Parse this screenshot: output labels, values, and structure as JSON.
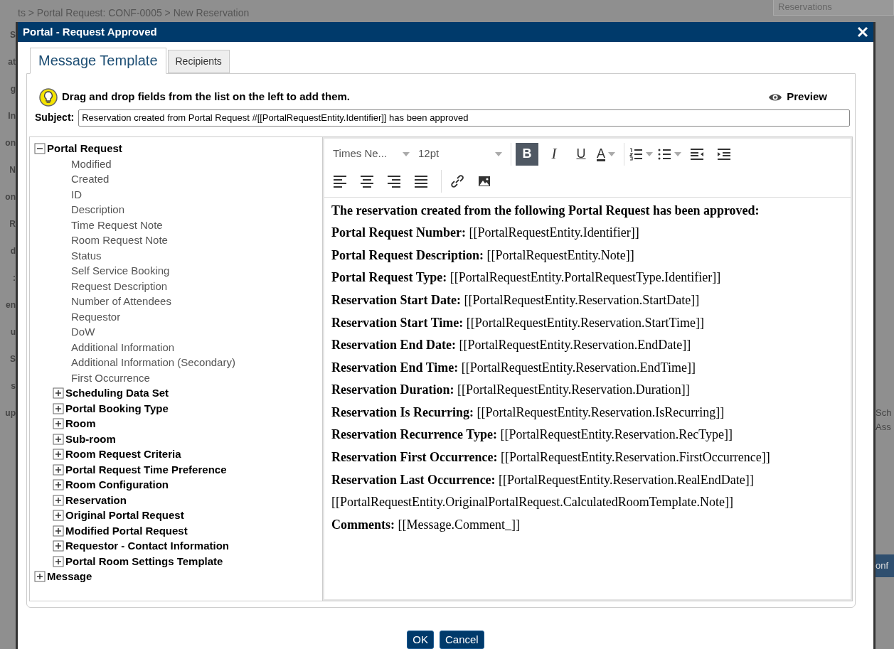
{
  "background": {
    "breadcrumb": "ts > Portal Request: CONF-0005 > New Reservation",
    "search_field": "Reservations",
    "left_fragments": [
      "S",
      "at",
      "g",
      "In",
      "on",
      "N",
      "on",
      "R",
      "d",
      ":",
      "en",
      "u",
      "S",
      "s",
      "up"
    ],
    "right_fragments": [
      "Sch",
      "Ass",
      "onf"
    ]
  },
  "dialog": {
    "title": "Portal - Request Approved",
    "tabs": [
      {
        "label": "Message Template",
        "selected": true
      },
      {
        "label": "Recipients",
        "selected": false
      }
    ],
    "hint": "Drag and drop fields from the list on the left to add them.",
    "preview": "Preview",
    "subject": {
      "label": "Subject:",
      "value": "Reservation created from Portal Request #[[PortalRequestEntity.Identifier]] has been approved"
    },
    "tree": [
      {
        "label": "Portal Request",
        "expanded": true,
        "children": [
          {
            "label": "Modified"
          },
          {
            "label": "Created"
          },
          {
            "label": "ID"
          },
          {
            "label": "Description"
          },
          {
            "label": "Time Request Note"
          },
          {
            "label": "Room Request Note"
          },
          {
            "label": "Status"
          },
          {
            "label": "Self Service Booking"
          },
          {
            "label": "Request Description"
          },
          {
            "label": "Number of Attendees"
          },
          {
            "label": "Requestor"
          },
          {
            "label": "DoW"
          },
          {
            "label": "Additional Information"
          },
          {
            "label": "Additional Information (Secondary)"
          },
          {
            "label": "First Occurrence"
          },
          {
            "label": "Scheduling Data Set",
            "expanded": false
          },
          {
            "label": "Portal Booking Type",
            "expanded": false
          },
          {
            "label": "Room",
            "expanded": false
          },
          {
            "label": "Sub-room",
            "expanded": false
          },
          {
            "label": "Room Request Criteria",
            "expanded": false
          },
          {
            "label": "Portal Request Time Preference",
            "expanded": false
          },
          {
            "label": "Room Configuration",
            "expanded": false
          },
          {
            "label": "Reservation",
            "expanded": false
          },
          {
            "label": "Original Portal Request",
            "expanded": false
          },
          {
            "label": "Modified Portal Request",
            "expanded": false
          },
          {
            "label": "Requestor - Contact Information",
            "expanded": false
          },
          {
            "label": "Portal Room Settings Template",
            "expanded": false
          }
        ]
      },
      {
        "label": "Message",
        "expanded": false
      }
    ],
    "toolbar": [
      [
        {
          "kind": "select",
          "label": "Times Ne..."
        },
        {
          "kind": "select",
          "label": "12pt"
        },
        {
          "kind": "sep"
        },
        {
          "kind": "letter",
          "label": "B",
          "active": true
        },
        {
          "kind": "letter",
          "label": "I",
          "active": false
        },
        {
          "kind": "letter",
          "label": "U",
          "active": false
        },
        {
          "kind": "color",
          "label": "A",
          "active": false
        },
        {
          "kind": "sep"
        },
        {
          "kind": "numbered-list",
          "active": false
        },
        {
          "kind": "bullet-list",
          "active": false
        },
        {
          "kind": "outdent",
          "active": false
        },
        {
          "kind": "indent",
          "active": false
        }
      ],
      [
        {
          "kind": "align-left",
          "active": false
        },
        {
          "kind": "align-center",
          "active": false
        },
        {
          "kind": "align-right",
          "active": false
        },
        {
          "kind": "justify",
          "active": false
        },
        {
          "kind": "sep"
        },
        {
          "kind": "link",
          "active": false
        },
        {
          "kind": "image",
          "active": false
        }
      ]
    ],
    "body": [
      {
        "kind": "heading",
        "text": "The reservation created from the following Portal Request has been approved:"
      },
      {
        "kind": "field",
        "label": "Portal Request Number:",
        "value": "[[PortalRequestEntity.Identifier]]"
      },
      {
        "kind": "field",
        "label": "Portal Request Description:",
        "value": "[[PortalRequestEntity.Note]]"
      },
      {
        "kind": "field",
        "label": "Portal Request Type:",
        "value": "[[PortalRequestEntity.PortalRequestType.Identifier]]"
      },
      {
        "kind": "field",
        "label": "Reservation Start Date:",
        "value": "[[PortalRequestEntity.Reservation.StartDate]]"
      },
      {
        "kind": "field",
        "label": "Reservation Start Time:",
        "value": "[[PortalRequestEntity.Reservation.StartTime]]"
      },
      {
        "kind": "field",
        "label": "Reservation End Date:",
        "value": "[[PortalRequestEntity.Reservation.EndDate]]"
      },
      {
        "kind": "field",
        "label": "Reservation End Time:",
        "value": "[[PortalRequestEntity.Reservation.EndTime]]"
      },
      {
        "kind": "field",
        "label": "Reservation Duration:",
        "value": "[[PortalRequestEntity.Reservation.Duration]]"
      },
      {
        "kind": "field",
        "label": "Reservation Is Recurring:",
        "value": "[[PortalRequestEntity.Reservation.IsRecurring]]"
      },
      {
        "kind": "field",
        "label": "Reservation Recurrence Type:",
        "value": "[[PortalRequestEntity.Reservation.RecType]]"
      },
      {
        "kind": "field",
        "label": "Reservation First Occurrence:",
        "value": "[[PortalRequestEntity.Reservation.FirstOccurrence]]"
      },
      {
        "kind": "field",
        "label": "Reservation Last Occurrence:",
        "value": "[[PortalRequestEntity.Reservation.RealEndDate]]"
      },
      {
        "kind": "plain",
        "text": "[[PortalRequestEntity.OriginalPortalRequest.CalculatedRoomTemplate.Note]]"
      },
      {
        "kind": "field",
        "label": "Comments:",
        "value": "[[Message.Comment_]]"
      }
    ],
    "buttons": [
      "OK",
      "Cancel"
    ]
  }
}
